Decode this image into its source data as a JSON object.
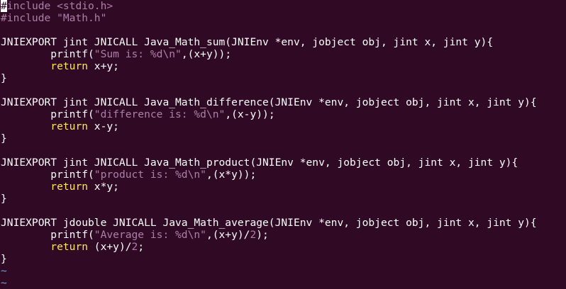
{
  "theme": {
    "background": "#300a24",
    "text": "#ffffff",
    "preprocessor": "#ad7fa8",
    "string": "#ad7fa8",
    "keyword": "#fce94f",
    "tilde": "#729fcf"
  },
  "lines": [
    [
      {
        "t": "#",
        "c": "cursor"
      },
      {
        "t": "include <stdio.h>",
        "c": "preproc"
      }
    ],
    [
      {
        "t": "#include \"Math.h\"",
        "c": "preproc"
      }
    ],
    [],
    [
      {
        "t": "JNIEXPORT jint JNICALL Java_Math_sum(JNIEnv *env, jobject obj, jint x, jint y){",
        "c": "plain"
      }
    ],
    [
      {
        "t": "        printf(",
        "c": "plain"
      },
      {
        "t": "\"Sum is: %d\\n\"",
        "c": "string"
      },
      {
        "t": ",(x+y));",
        "c": "plain"
      }
    ],
    [
      {
        "t": "        ",
        "c": "plain"
      },
      {
        "t": "return",
        "c": "keyword"
      },
      {
        "t": " x+y;",
        "c": "plain"
      }
    ],
    [
      {
        "t": "}",
        "c": "plain"
      }
    ],
    [],
    [
      {
        "t": "JNIEXPORT jint JNICALL Java_Math_difference(JNIEnv *env, jobject obj, jint x, jint y){",
        "c": "plain"
      }
    ],
    [
      {
        "t": "        printf(",
        "c": "plain"
      },
      {
        "t": "\"difference is: %d\\n\"",
        "c": "string"
      },
      {
        "t": ",(x-y));",
        "c": "plain"
      }
    ],
    [
      {
        "t": "        ",
        "c": "plain"
      },
      {
        "t": "return",
        "c": "keyword"
      },
      {
        "t": " x-y;",
        "c": "plain"
      }
    ],
    [
      {
        "t": "}",
        "c": "plain"
      }
    ],
    [],
    [
      {
        "t": "JNIEXPORT jint JNICALL Java_Math_product(JNIEnv *env, jobject obj, jint x, jint y){",
        "c": "plain"
      }
    ],
    [
      {
        "t": "        printf(",
        "c": "plain"
      },
      {
        "t": "\"product is: %d\\n\"",
        "c": "string"
      },
      {
        "t": ",(x*y));",
        "c": "plain"
      }
    ],
    [
      {
        "t": "        ",
        "c": "plain"
      },
      {
        "t": "return",
        "c": "keyword"
      },
      {
        "t": " x*y;",
        "c": "plain"
      }
    ],
    [
      {
        "t": "}",
        "c": "plain"
      }
    ],
    [],
    [
      {
        "t": "JNIEXPORT jdouble JNICALL Java_Math_average(JNIEnv *env, jobject obj, jint x, jint y){",
        "c": "plain"
      }
    ],
    [
      {
        "t": "        printf(",
        "c": "plain"
      },
      {
        "t": "\"Average is: %d\\n\"",
        "c": "string"
      },
      {
        "t": ",(x+y)/",
        "c": "plain"
      },
      {
        "t": "2",
        "c": "number"
      },
      {
        "t": ");",
        "c": "plain"
      }
    ],
    [
      {
        "t": "        ",
        "c": "plain"
      },
      {
        "t": "return",
        "c": "keyword"
      },
      {
        "t": " (x+y)/",
        "c": "plain"
      },
      {
        "t": "2",
        "c": "number"
      },
      {
        "t": ";",
        "c": "plain"
      }
    ],
    [
      {
        "t": "}",
        "c": "plain"
      }
    ],
    [
      {
        "t": "~",
        "c": "tilde"
      }
    ],
    [
      {
        "t": "~",
        "c": "tilde"
      }
    ]
  ]
}
